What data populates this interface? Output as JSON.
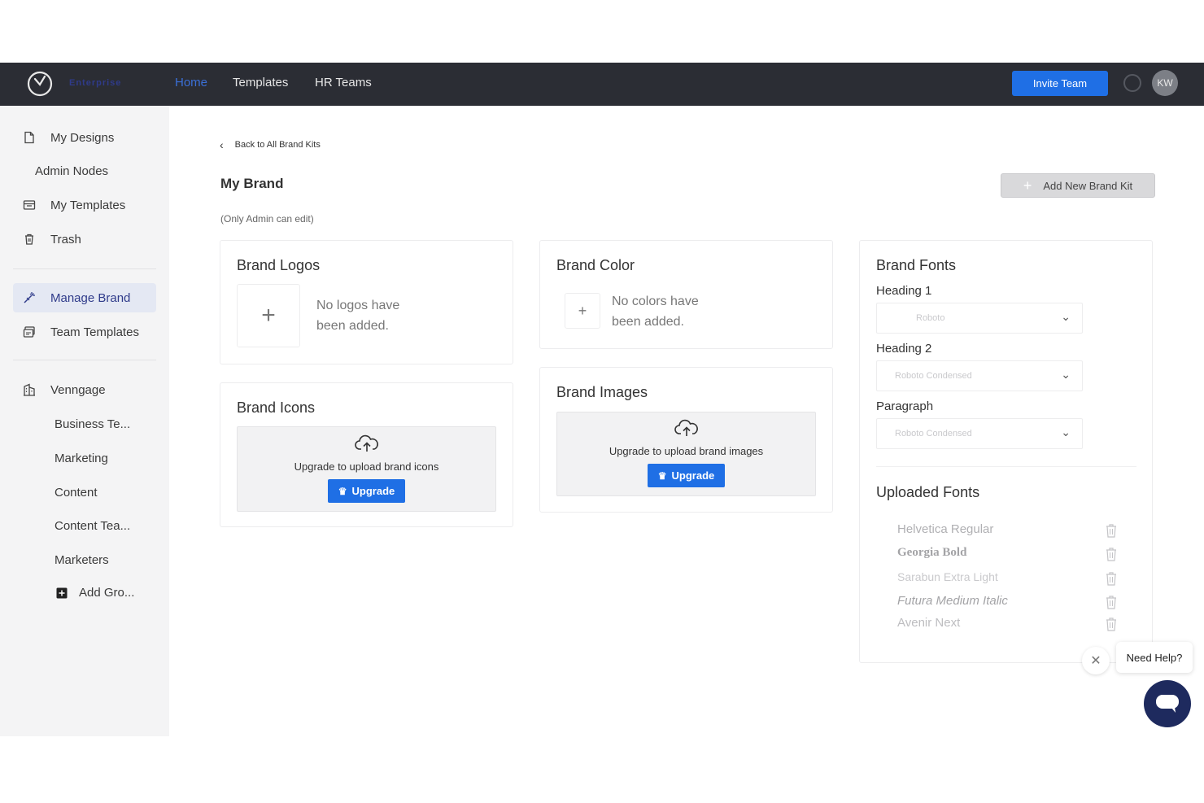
{
  "topnav": {
    "brand_tag": "Enterprise",
    "links": [
      {
        "label": "Home",
        "active": true
      },
      {
        "label": "Templates",
        "active": false
      },
      {
        "label": "HR Teams",
        "active": false
      }
    ],
    "invite_label": "Invite Team",
    "avatar_initials": "KW"
  },
  "sidebar": {
    "items": [
      {
        "label": "My Designs",
        "icon": "document-icon"
      },
      {
        "label": "Admin Nodes"
      },
      {
        "label": "My Templates",
        "icon": "template-icon"
      },
      {
        "label": "Trash",
        "icon": "trash-icon"
      },
      {
        "label": "Manage Brand",
        "icon": "magic-wand-icon",
        "active": true
      },
      {
        "label": "Team Templates",
        "icon": "team-template-icon"
      },
      {
        "label": "Venngage",
        "icon": "building-icon"
      }
    ],
    "groups": [
      "Business Te...",
      "Marketing",
      "Content",
      "Content Tea...",
      "Marketers"
    ],
    "add_group_label": "Add Gro..."
  },
  "main": {
    "back_label": "Back to All Brand Kits",
    "title": "My Brand",
    "subtitle": "(Only Admin can edit)",
    "add_kit_label": "Add New Brand Kit",
    "logos": {
      "title": "Brand Logos",
      "empty": "No logos have been added."
    },
    "color": {
      "title": "Brand Color",
      "empty": "No colors have been added."
    },
    "icons": {
      "title": "Brand Icons",
      "upload_text": "Upgrade to upload brand icons",
      "upgrade_label": "Upgrade"
    },
    "images": {
      "title": "Brand Images",
      "upload_text": "Upgrade to upload brand images",
      "upgrade_label": "Upgrade"
    },
    "fonts": {
      "title": "Brand Fonts",
      "heading1_label": "Heading 1",
      "heading1_value": "Roboto",
      "heading2_label": "Heading 2",
      "heading2_value": "Roboto Condensed",
      "paragraph_label": "Paragraph",
      "paragraph_value": "Roboto Condensed",
      "uploaded_title": "Uploaded Fonts",
      "uploaded": [
        "Helvetica Regular",
        "Georgia Bold",
        "Sarabun Extra Light",
        "Futura Medium Italic",
        "Avenir Next"
      ]
    }
  },
  "help": {
    "label": "Need Help?"
  },
  "colors": {
    "accent": "#1f6fe5",
    "nav_bg": "#2b2d34",
    "active_link": "#3b6fd6"
  }
}
